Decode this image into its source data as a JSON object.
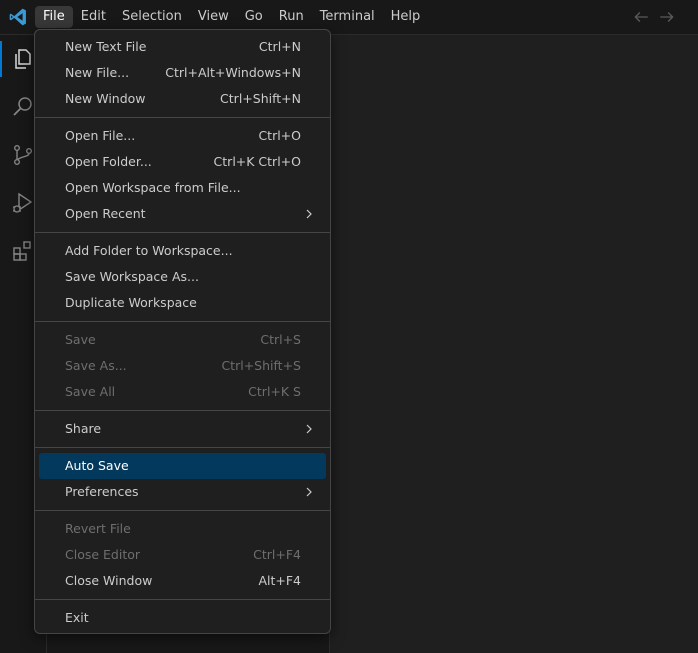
{
  "menubar": {
    "items": [
      "File",
      "Edit",
      "Selection",
      "View",
      "Go",
      "Run",
      "Terminal",
      "Help"
    ],
    "active_index": 0
  },
  "colors": {
    "accent": "#0078d4",
    "highlight": "#04395e",
    "logo": "#3c99d4"
  },
  "file_menu": {
    "new_text_file": {
      "label": "New Text File",
      "shortcut": "Ctrl+N"
    },
    "new_file": {
      "label": "New File...",
      "shortcut": "Ctrl+Alt+Windows+N"
    },
    "new_window": {
      "label": "New Window",
      "shortcut": "Ctrl+Shift+N"
    },
    "open_file": {
      "label": "Open File...",
      "shortcut": "Ctrl+O"
    },
    "open_folder": {
      "label": "Open Folder...",
      "shortcut": "Ctrl+K Ctrl+O"
    },
    "open_workspace": {
      "label": "Open Workspace from File..."
    },
    "open_recent": {
      "label": "Open Recent"
    },
    "add_folder": {
      "label": "Add Folder to Workspace..."
    },
    "save_workspace_as": {
      "label": "Save Workspace As..."
    },
    "duplicate_workspace": {
      "label": "Duplicate Workspace"
    },
    "save": {
      "label": "Save",
      "shortcut": "Ctrl+S"
    },
    "save_as": {
      "label": "Save As...",
      "shortcut": "Ctrl+Shift+S"
    },
    "save_all": {
      "label": "Save All",
      "shortcut": "Ctrl+K S"
    },
    "share": {
      "label": "Share"
    },
    "auto_save": {
      "label": "Auto Save"
    },
    "preferences": {
      "label": "Preferences"
    },
    "revert_file": {
      "label": "Revert File"
    },
    "close_editor": {
      "label": "Close Editor",
      "shortcut": "Ctrl+F4"
    },
    "close_window": {
      "label": "Close Window",
      "shortcut": "Alt+F4"
    },
    "exit": {
      "label": "Exit"
    }
  },
  "icons": {
    "logo": "vscode-logo-icon",
    "back": "arrow-left-icon",
    "forward": "arrow-right-icon",
    "activity": [
      "explorer-icon",
      "search-icon",
      "source-control-icon",
      "run-debug-icon",
      "extensions-icon"
    ]
  }
}
